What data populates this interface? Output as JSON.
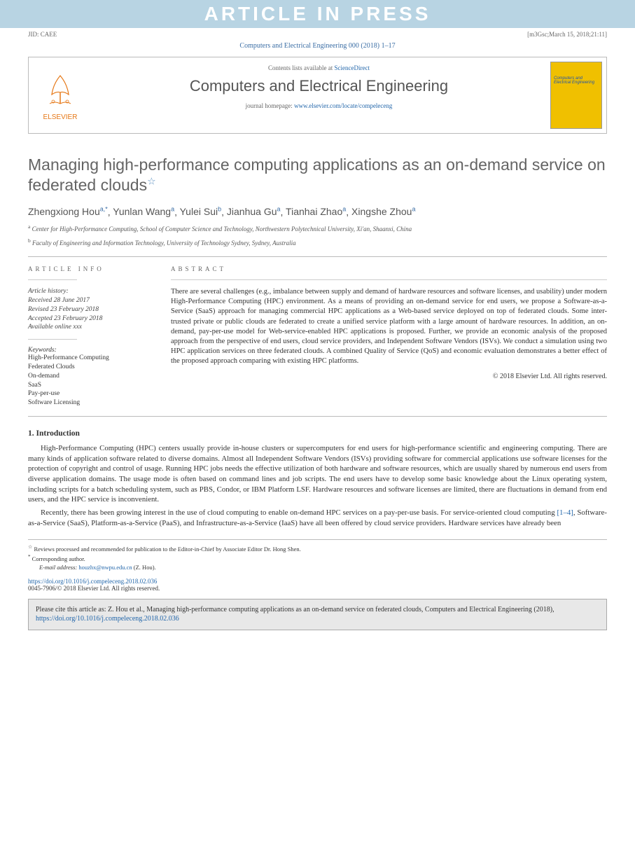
{
  "watermark": "ARTICLE IN PRESS",
  "top_meta": {
    "left": "JID: CAEE",
    "right": "[m3Gsc;March 15, 2018;21:11]"
  },
  "journal_ref": "Computers and Electrical Engineering 000 (2018) 1–17",
  "header": {
    "contents_prefix": "Contents lists available at ",
    "contents_link": "ScienceDirect",
    "journal_title": "Computers and Electrical Engineering",
    "homepage_prefix": "journal homepage: ",
    "homepage_link": "www.elsevier.com/locate/compeleceng",
    "elsevier": "ELSEVIER",
    "cover_title": "Computers and Electrical Engineering"
  },
  "title": "Managing high-performance computing applications as an on-demand service on federated clouds",
  "title_star": "☆",
  "authors": [
    {
      "name": "Zhengxiong Hou",
      "sup": "a,*"
    },
    {
      "name": "Yunlan Wang",
      "sup": "a"
    },
    {
      "name": "Yulei Sui",
      "sup": "b"
    },
    {
      "name": "Jianhua Gu",
      "sup": "a"
    },
    {
      "name": "Tianhai Zhao",
      "sup": "a"
    },
    {
      "name": "Xingshe Zhou",
      "sup": "a"
    }
  ],
  "affiliations": {
    "a": "Center for High-Performance Computing, School of Computer Science and Technology, Northwestern Polytechnical University, Xi'an, Shaanxi, China",
    "b": "Faculty of Engineering and Information Technology, University of Technology Sydney, Sydney, Australia"
  },
  "info": {
    "heading": "ARTICLE INFO",
    "history_label": "Article history:",
    "history": [
      "Received 28 June 2017",
      "Revised 23 February 2018",
      "Accepted 23 February 2018",
      "Available online xxx"
    ],
    "keywords_label": "Keywords:",
    "keywords": [
      "High-Performance Computing",
      "Federated Clouds",
      "On-demand",
      "SaaS",
      "Pay-per-use",
      "Software Licensing"
    ]
  },
  "abstract": {
    "heading": "ABSTRACT",
    "text": "There are several challenges (e.g., imbalance between supply and demand of hardware resources and software licenses, and usability) under modern High-Performance Computing (HPC) environment. As a means of providing an on-demand service for end users, we propose a Software-as-a-Service (SaaS) approach for managing commercial HPC applications as a Web-based service deployed on top of federated clouds. Some inter-trusted private or public clouds are federated to create a unified service platform with a large amount of hardware resources. In addition, an on-demand, pay-per-use model for Web-service-enabled HPC applications is proposed. Further, we provide an economic analysis of the proposed approach from the perspective of end users, cloud service providers, and Independent Software Vendors (ISVs). We conduct a simulation using two HPC application services on three federated clouds. A combined Quality of Service (QoS) and economic evaluation demonstrates a better effect of the proposed approach comparing with existing HPC platforms.",
    "copyright": "© 2018 Elsevier Ltd. All rights reserved."
  },
  "body": {
    "section1_head": "1. Introduction",
    "para1": "High-Performance Computing (HPC) centers usually provide in-house clusters or supercomputers for end users for high-performance scientific and engineering computing. There are many kinds of application software related to diverse domains. Almost all Independent Software Vendors (ISVs) providing software for commercial applications use software licenses for the protection of copyright and control of usage. Running HPC jobs needs the effective utilization of both hardware and software resources, which are usually shared by numerous end users from diverse application domains. The usage mode is often based on command lines and job scripts. The end users have to develop some basic knowledge about the Linux operating system, including scripts for a batch scheduling system, such as PBS, Condor, or IBM Platform LSF. Hardware resources and software licenses are limited, there are fluctuations in demand from end users, and the HPC service is inconvenient.",
    "para2_pre": "Recently, there has been growing interest in the use of cloud computing to enable on-demand HPC services on a pay-per-use basis. For service-oriented cloud computing ",
    "para2_link": "[1–4]",
    "para2_post": ", Software-as-a-Service (SaaS), Platform-as-a-Service (PaaS), and Infrastructure-as-a-Service (IaaS) have all been offered by cloud service providers. Hardware services have already been"
  },
  "footnotes": {
    "star": "☆",
    "star_text": "Reviews processed and recommended for publication to the Editor-in-Chief by Associate Editor Dr. Hong Shen.",
    "corr_mark": "*",
    "corr_text": "Corresponding author.",
    "email_label": "E-mail address:",
    "email": "houzhx@nwpu.edu.cn",
    "email_suffix": " (Z. Hou)."
  },
  "doi": {
    "url": "https://doi.org/10.1016/j.compeleceng.2018.02.036",
    "issn_line": "0045-7906/© 2018 Elsevier Ltd. All rights reserved."
  },
  "citebox": {
    "text_pre": "Please cite this article as: Z. Hou et al., Managing high-performance computing applications as an on-demand service on federated clouds, Computers and Electrical Engineering (2018), ",
    "link": "https://doi.org/10.1016/j.compeleceng.2018.02.036"
  }
}
